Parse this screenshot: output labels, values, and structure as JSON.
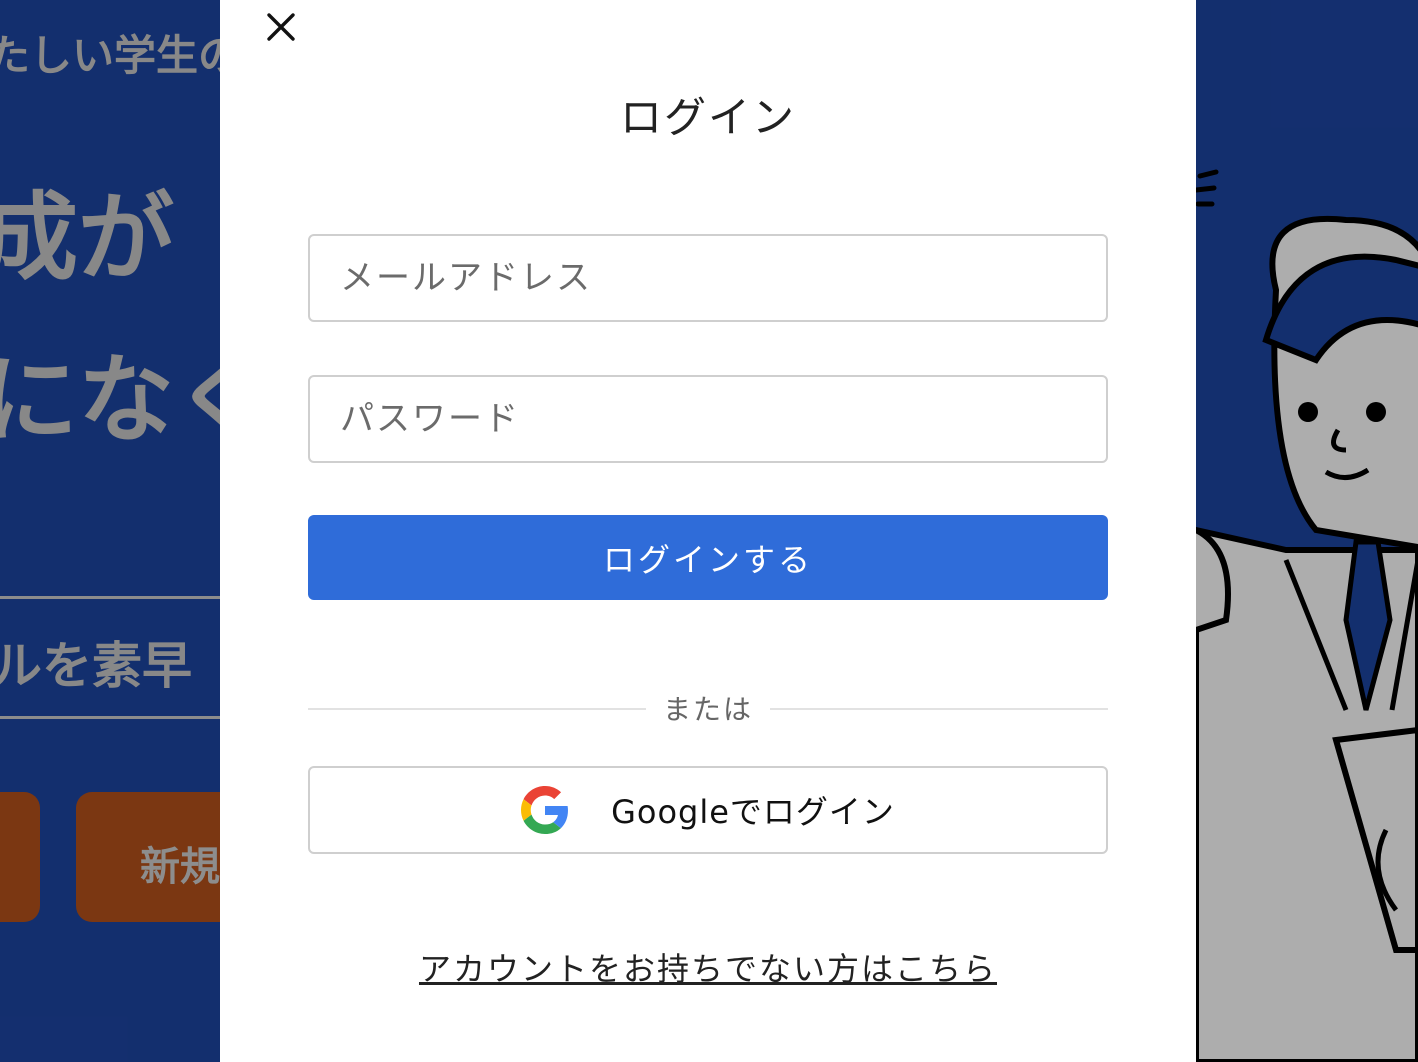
{
  "background": {
    "tagline": "たしい学生の",
    "headline_line1": "成が",
    "headline_line2": "になく",
    "subline": "ルを素早",
    "button_label": "新規"
  },
  "modal": {
    "title": "ログイン",
    "email_placeholder": "メールアドレス",
    "password_placeholder": "パスワード",
    "login_button_label": "ログインする",
    "divider_text": "または",
    "google_button_label": "Googleでログイン",
    "signup_link_label": "アカウントをお持ちでない方はこちら"
  },
  "icons": {
    "close": "close-icon",
    "google": "google-icon"
  },
  "colors": {
    "primary_button": "#2f6cd9",
    "background_page": "#1d46a3",
    "background_cta": "#b5521b",
    "modal_background": "#ffffff"
  }
}
